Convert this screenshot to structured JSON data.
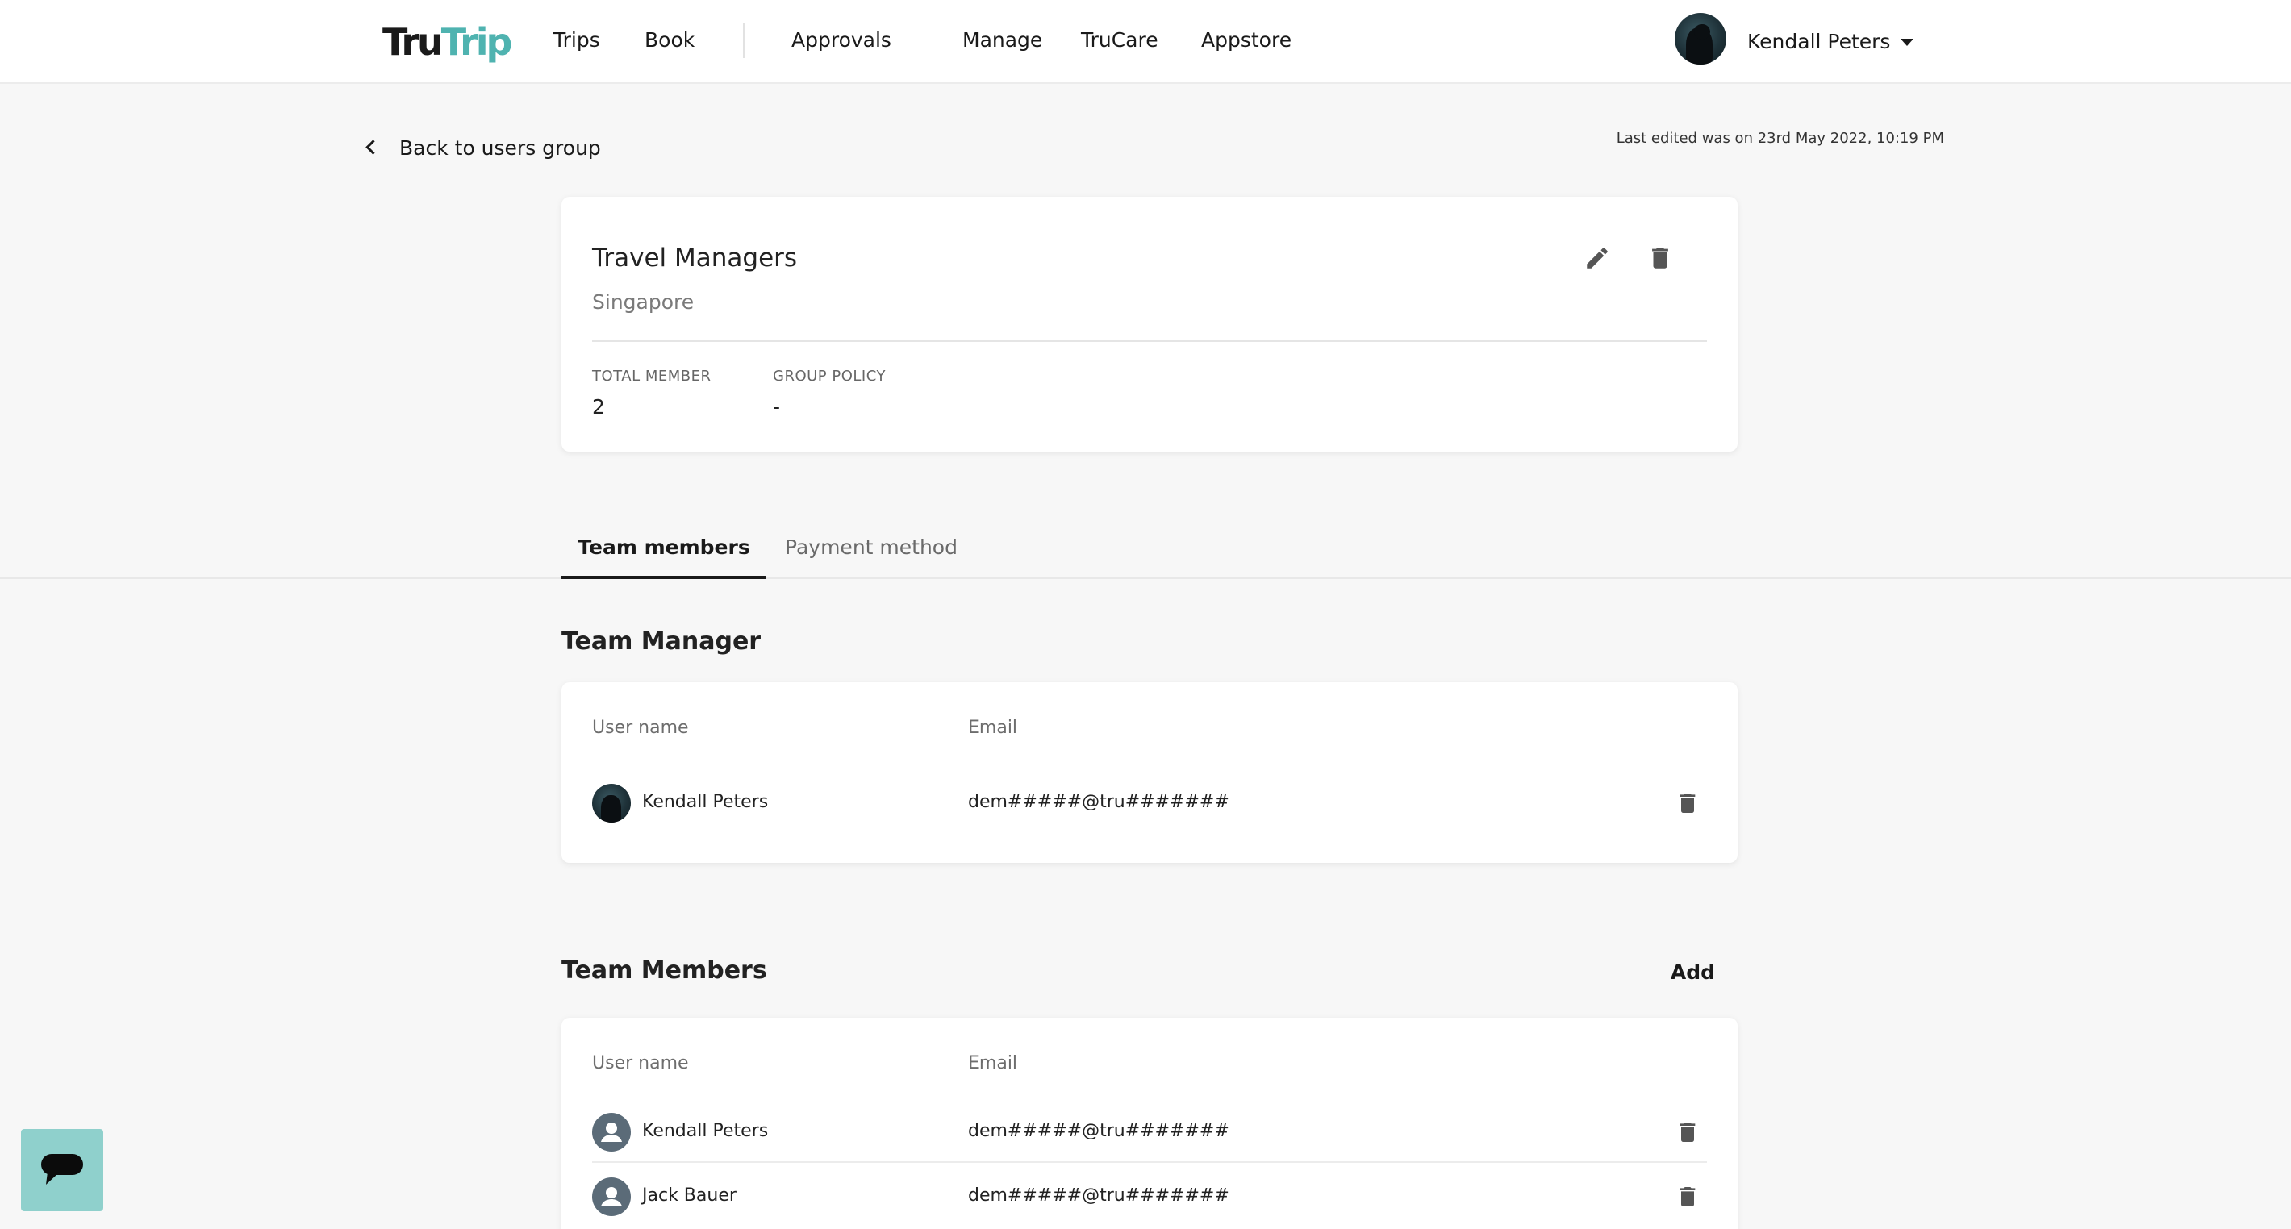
{
  "header": {
    "logo": {
      "part1": "Tru",
      "part2": "Trip"
    },
    "nav": [
      "Trips",
      "Book",
      "Approvals",
      "Manage",
      "TruCare",
      "Appstore"
    ],
    "user": {
      "name": "Kendall Peters"
    }
  },
  "page": {
    "back_label": "Back to users group",
    "last_edited": "Last edited was on 23rd May 2022, 10:19 PM"
  },
  "group": {
    "name": "Travel Managers",
    "location": "Singapore",
    "total_member_label": "TOTAL MEMBER",
    "total_member_value": "2",
    "group_policy_label": "GROUP POLICY",
    "group_policy_value": "-"
  },
  "tabs": [
    {
      "label": "Team members",
      "active": true
    },
    {
      "label": "Payment method",
      "active": false
    }
  ],
  "team_manager": {
    "title": "Team Manager",
    "columns": {
      "user_name": "User name",
      "email": "Email"
    },
    "rows": [
      {
        "name": "Kendall Peters",
        "email": "dem#####@tru#######",
        "avatar": "photo"
      }
    ]
  },
  "team_members": {
    "title": "Team Members",
    "add_label": "Add",
    "columns": {
      "user_name": "User name",
      "email": "Email"
    },
    "rows": [
      {
        "name": "Kendall Peters",
        "email": "dem#####@tru#######",
        "avatar": "generic"
      },
      {
        "name": "Jack Bauer",
        "email": "dem#####@tru#######",
        "avatar": "generic"
      }
    ]
  },
  "colors": {
    "accent": "#4fb3b0",
    "chat_widget": "#8fd0cc",
    "background": "#f7f7f7"
  },
  "icons": {
    "edit": "pencil-icon",
    "delete": "trash-icon",
    "back": "chevron-left-icon",
    "dropdown": "caret-down-icon",
    "chat": "chat-bubble-icon",
    "user": "user-icon"
  }
}
